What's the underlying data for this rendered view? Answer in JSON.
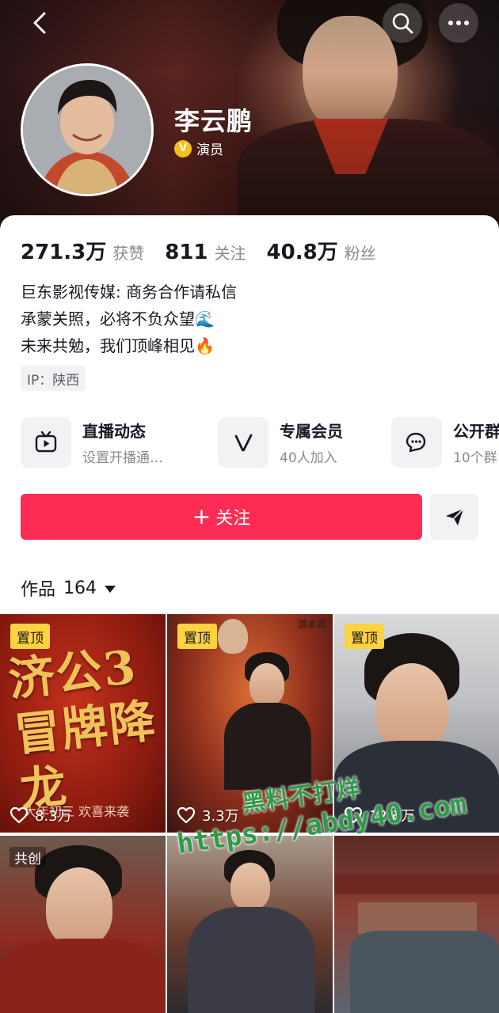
{
  "header": {
    "back_icon": "back-arrow-icon",
    "search_icon": "search-icon",
    "more_icon": "more-dots-icon"
  },
  "profile": {
    "name": "李云鹏",
    "verified_label": "演员",
    "verified_badge_letter": "V",
    "badge_color": "#f5c018"
  },
  "stats": [
    {
      "value": "271.3万",
      "label": "获赞"
    },
    {
      "value": "811",
      "label": "关注"
    },
    {
      "value": "40.8万",
      "label": "粉丝"
    }
  ],
  "bio": {
    "line1": "巨东影视传媒: 商务合作请私信",
    "line2": "承蒙关照，必将不负众望🌊",
    "line3": "未来共勉，我们顶峰相见🔥"
  },
  "ip_tag": "IP：陕西",
  "features": [
    {
      "title": "直播动态",
      "subtitle": "设置开播通…",
      "icon": "tv-icon"
    },
    {
      "title": "专属会员",
      "subtitle": "40人加入",
      "icon": "v-logo-icon"
    },
    {
      "title": "公开群",
      "subtitle": "10个群",
      "icon": "chat-bubble-icon"
    }
  ],
  "actions": {
    "follow_label": "关注",
    "follow_prefix": "+",
    "share_icon": "send-icon",
    "accent": "#fe2c55"
  },
  "works": {
    "label": "作品",
    "count": "164",
    "tiles": [
      {
        "badge": "置顶",
        "likes": "8.3万",
        "title_art": "济公3冒牌降龙",
        "caption": "大年初三 欢喜来袭"
      },
      {
        "badge": "置顶",
        "likes": "3.3万",
        "corner_text": "游本昌"
      },
      {
        "badge": "置顶",
        "likes": "12.6万"
      },
      {
        "badge": "共创"
      },
      {},
      {}
    ]
  },
  "watermark": {
    "line1": "黑料不打烊",
    "line2": "https://abdy40.com"
  }
}
